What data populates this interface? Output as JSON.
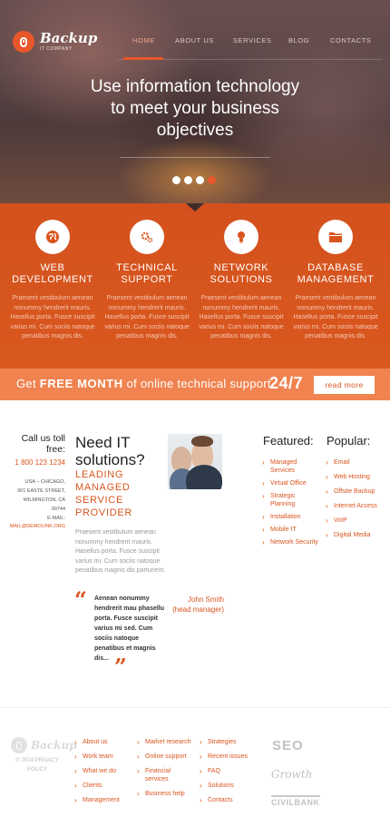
{
  "brand": {
    "name": "Backup",
    "tagline": "IT COMPANY"
  },
  "nav": [
    {
      "label": "HOME",
      "active": true
    },
    {
      "label": "ABOUT US",
      "active": false
    },
    {
      "label": "SERVICES",
      "active": false
    },
    {
      "label": "BLOG",
      "active": false
    },
    {
      "label": "CONTACTS",
      "active": false
    }
  ],
  "hero": {
    "title_lines": [
      "Use information technology",
      "to meet your business",
      "objectives"
    ],
    "slides_total": 4,
    "slide_active": 4
  },
  "services": [
    {
      "icon": "globe-icon",
      "title_lines": [
        "WEB",
        "DEVELOPMENT"
      ],
      "text": "Praesent vestibulum aenean nonummy hendrerit mauris. Hasellus porta. Fusce suscipit varius mi. Cum sociis natoque penatibus magnis dis."
    },
    {
      "icon": "gears-icon",
      "title_lines": [
        "TECHNICAL",
        "SUPPORT"
      ],
      "text": "Praesent vestibulum aenean nonummy hendrerit mauris. Hasellus porta. Fusce suscipit varius mi. Cum sociis natoque penatibus magnis dis."
    },
    {
      "icon": "lightbulb-icon",
      "title_lines": [
        "NETWORK",
        "SOLUTIONS"
      ],
      "text": "Praesent vestibulum aenean nonummy hendrerit mauris. Hasellus porta. Fusce suscipit varius mi. Cum sociis natoque penatibus magnis dis."
    },
    {
      "icon": "folder-icon",
      "title_lines": [
        "DATABASE",
        "MANAGEMENT"
      ],
      "text": "Praesent vestibulum aenean nonummy hendrerit mauris. Hasellus porta. Fusce suscipit varius mi. Cum sociis natoque penatibus magnis dis."
    }
  ],
  "promo": {
    "prefix": "Get",
    "highlight": "FREE MONTH",
    "suffix": "of online technical support",
    "hours": "24/7",
    "button": "read more"
  },
  "contact": {
    "title": "Call us toll free:",
    "phone": "1 800 123 1234",
    "address_lines": [
      "USA – CHICAGO,",
      "901 EASTE STREET,",
      "WILMINGTON, CA",
      "90744",
      "E-MAIL:"
    ],
    "email": "MAIL@DEMOLINK.ORG"
  },
  "intro": {
    "title_lines": [
      "Need IT",
      "solutions?"
    ],
    "subtitle_lines": [
      "LEADING",
      "MANAGED",
      "SERVICE",
      "PROVIDER"
    ],
    "text": "Praesent vestibulum aenean nonummy hendrerit mauris. Hasellus porta. Fusce suscipit varius mi. Cum sociis natoque penatibus magnis dis parturient."
  },
  "quote": {
    "text": "Aenean nonummy hendrerit mau phasellu porta. Fusce suscipit varius mi sed. Cum sociis natoque penatibus et magnis dis...",
    "author": "John Smith",
    "role": "(head manager)"
  },
  "featured": {
    "title": "Featured:",
    "items": [
      "Managed Services",
      "Virtual Office",
      "Strategic Planning",
      "Installation",
      "Mobile IT",
      "Network Security"
    ]
  },
  "popular": {
    "title": "Popular:",
    "items": [
      "Email",
      "Web Hosting",
      "Offsite Backup",
      "Internet Access",
      "VoIP",
      "Digital Media"
    ]
  },
  "footer": {
    "logo": "Backup",
    "copyright_lines": [
      "© 2014 PRIVACY",
      "POLICY"
    ],
    "col1": [
      "About us",
      "Work team",
      "What we do",
      "Clients",
      "Management"
    ],
    "col2": [
      "Market research",
      "Online support",
      "Financial services",
      "Business help"
    ],
    "col3": [
      "Strategies",
      "Recent issues",
      "FAQ",
      "Solutions",
      "Contacts"
    ],
    "partners": [
      "SEO",
      "Growth",
      "CIVILBANK"
    ]
  },
  "colors": {
    "accent": "#d9551f",
    "promo": "#f08350"
  }
}
